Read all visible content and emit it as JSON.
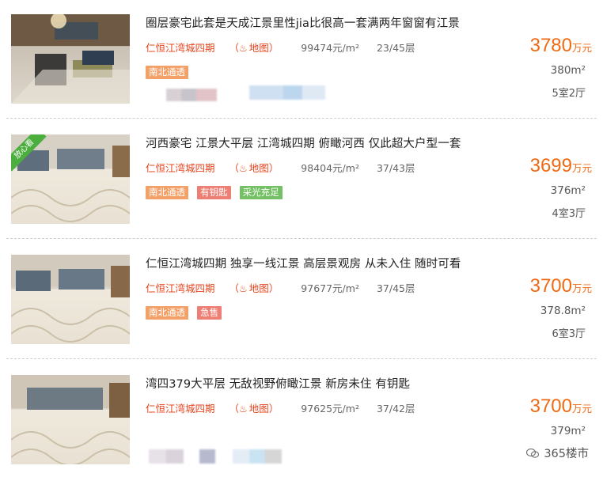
{
  "listings": [
    {
      "title": "圈层豪宅此套是天成江景里性jia比很高一套满两年窗窗有江景",
      "community": "仁恒江湾城四期",
      "map_label": "地图",
      "unit_price": "99474元/m²",
      "floor": "23/45层",
      "tags": [
        "南北通透"
      ],
      "price": "3780",
      "price_unit": "万元",
      "area": "380m²",
      "rooms": "5室2厅"
    },
    {
      "title": "河西豪宅 江景大平层 江湾城四期 俯瞰河西 仅此超大户型一套",
      "community": "仁恒江湾城四期",
      "map_label": "地图",
      "unit_price": "98404元/m²",
      "floor": "37/43层",
      "tags": [
        "南北通透",
        "有钥匙",
        "采光充足"
      ],
      "badge": "放心看",
      "price": "3699",
      "price_unit": "万元",
      "area": "376m²",
      "rooms": "4室3厅"
    },
    {
      "title": "仁恒江湾城四期 独享一线江景 高层景观房 从未入住 随时可看",
      "community": "仁恒江湾城四期",
      "map_label": "地图",
      "unit_price": "97677元/m²",
      "floor": "37/45层",
      "tags": [
        "南北通透",
        "急售"
      ],
      "price": "3700",
      "price_unit": "万元",
      "area": "378.8m²",
      "rooms": "6室3厅"
    },
    {
      "title": "湾四379大平层 无敌视野俯瞰江景 新房未住 有钥匙",
      "community": "仁恒江湾城四期",
      "map_label": "地图",
      "unit_price": "97625元/m²",
      "floor": "37/42层",
      "tags": [],
      "price": "3700",
      "price_unit": "万元",
      "area": "379m²",
      "rooms": ""
    }
  ],
  "watermark": "365楼市",
  "colors": {
    "price": "#f06a14",
    "community": "#e8451d",
    "tag_orange": "#f3a069",
    "tag_pink": "#ee7f74",
    "tag_green": "#74c064",
    "badge": "#4cae3f"
  }
}
